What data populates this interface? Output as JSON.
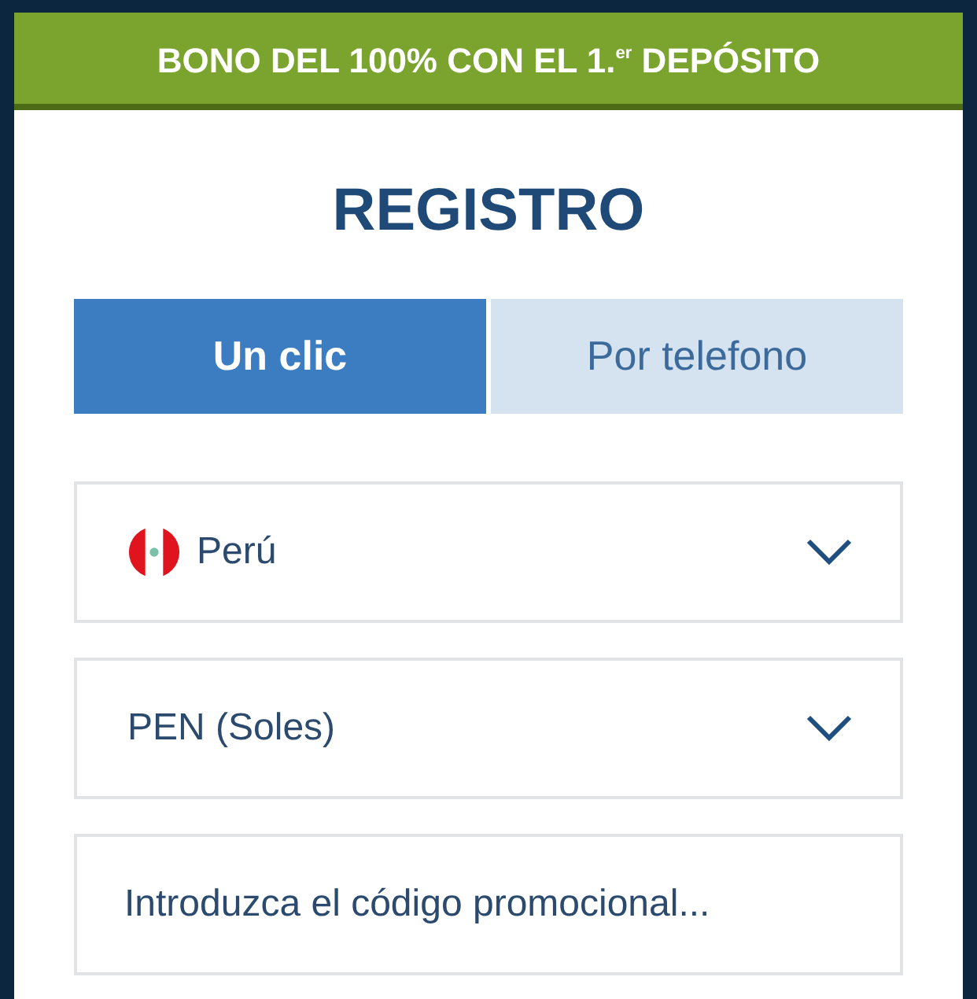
{
  "banner": {
    "text": "BONO DEL 100% CON EL 1.$^{er}$ DEPÓSITO"
  },
  "title": "REGISTRO",
  "tabs": [
    {
      "label": "Un clic",
      "selected": true
    },
    {
      "label": "Por telefono",
      "selected": false
    }
  ],
  "fields": [
    {
      "kind": "country",
      "value": "Perú"
    },
    {
      "kind": "select",
      "value": "PEN (Soles)"
    },
    {
      "kind": "input",
      "placeholder": "Introduzca el código promocional..."
    }
  ]
}
